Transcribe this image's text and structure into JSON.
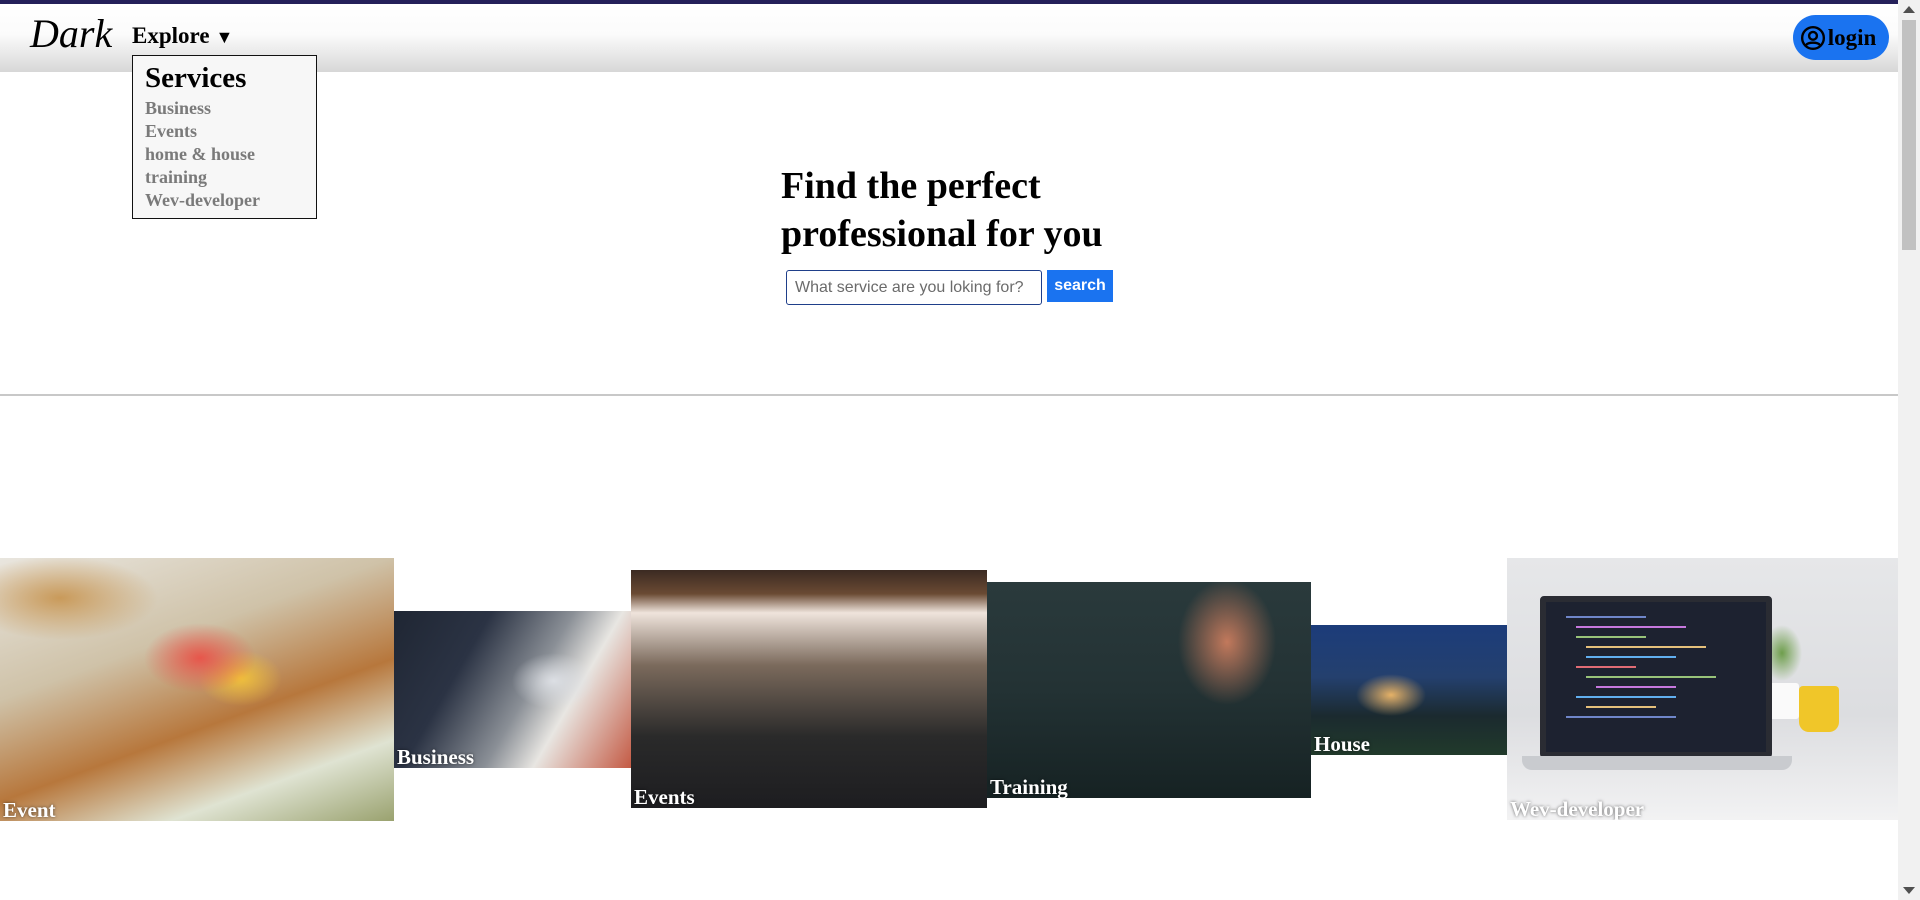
{
  "header": {
    "logo": "Dark",
    "explore_label": "Explore",
    "login_label": "login"
  },
  "dropdown": {
    "title": "Services",
    "items": [
      "Business",
      "Events",
      "home & house",
      "training",
      "Wev-developer"
    ]
  },
  "hero": {
    "title_line1": "Find the perfect",
    "title_line2": "professional for you",
    "search_placeholder": "What service are you loking for?",
    "search_button": "search"
  },
  "gallery": [
    {
      "label": "Event"
    },
    {
      "label": "Business"
    },
    {
      "label": "Events"
    },
    {
      "label": "Training"
    },
    {
      "label": "House"
    },
    {
      "label": "Wev-developer"
    }
  ],
  "colors": {
    "accent_blue": "#1a73f0",
    "top_border": "#25205a"
  }
}
